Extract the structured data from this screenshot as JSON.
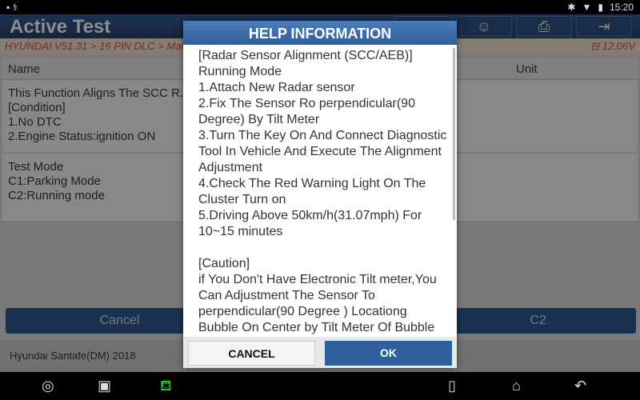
{
  "status": {
    "time": "15:20"
  },
  "header": {
    "title": "Active Test",
    "toolbar": [
      "home-icon",
      "headset-icon",
      "printer-icon",
      "exit-icon"
    ]
  },
  "breadcrumb": {
    "path": "HYUNDAI V51.31 > 16 PIN DLC > Manual Selection > ... > Smart Cruise Control",
    "voltage": "12.06V"
  },
  "table": {
    "headers": {
      "name": "Name",
      "unit": "Unit"
    },
    "rows": [
      "This Function Aligns The SCC R...\n[Condition]\n1.No DTC\n2.Engine Status:ignition ON",
      "Test Mode\nC1:Parking Mode\nC2:Running mode"
    ]
  },
  "buttons": {
    "cancel": "Cancel",
    "c2": "C2"
  },
  "footer": {
    "vehicle": "Hyundai Santafe(DM) 2018"
  },
  "dialog": {
    "title": "HELP INFORMATION",
    "body": "[Radar Sensor Alignment (SCC/AEB)]\nRunning Mode\n1.Attach New Radar sensor\n2.Fix The Sensor Ro perpendicular(90 Degree) By Tilt Meter\n3.Turn The Key On And Connect Diagnostic Tool In Vehicle And Execute The Alignment Adjustment\n4.Check The Red Warning Light On The Cluster Turn on\n5.Driving Above 50km/h(31.07mph) For 10~15 minutes\n\n[Caution]\nif You Don't Have Electronic Tilt meter,You Can Adjustment The Sensor To perpendicular(90 Degree ) Locationg Bubble On Center by Tilt Meter Of Bubble",
    "cancel": "CANCEL",
    "ok": "OK"
  },
  "colors": {
    "dialog_header": "#3a6aa8",
    "ok_button": "#2f5f9c",
    "breadcrumb_text": "#c0392b"
  }
}
